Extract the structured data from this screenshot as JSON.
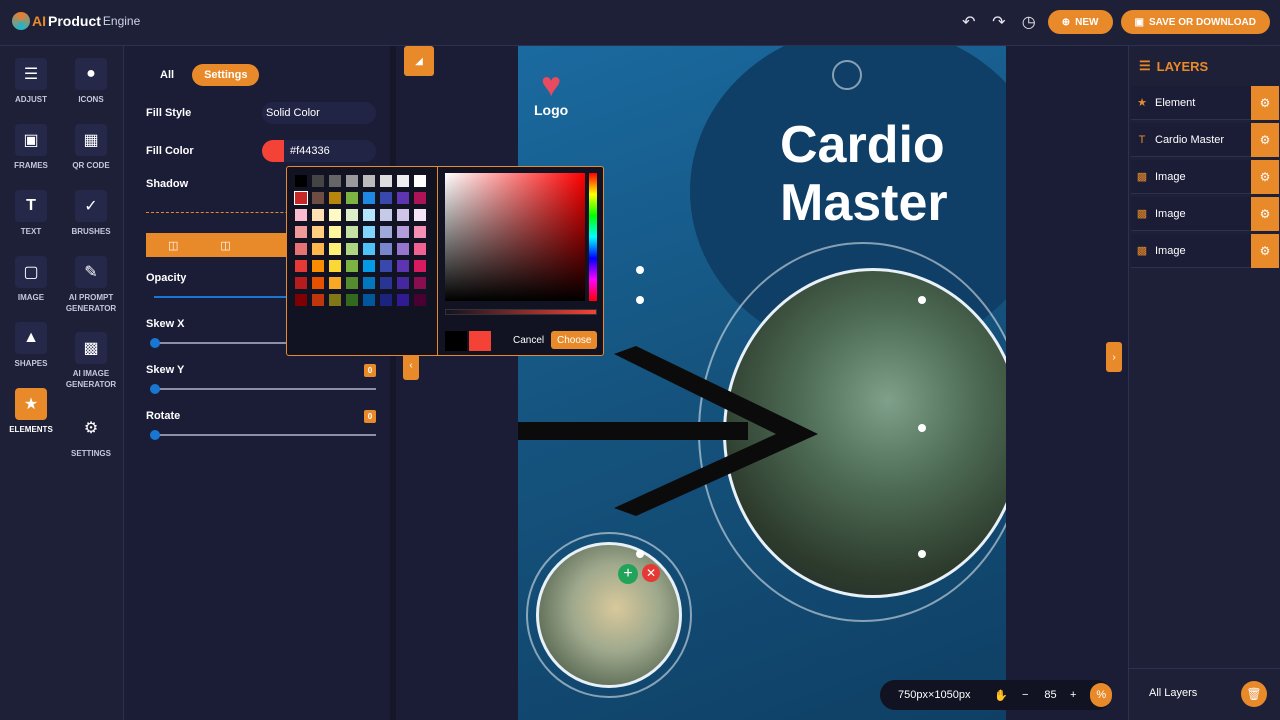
{
  "app": {
    "brand_ai": "AI",
    "brand_product": "Product",
    "brand_engine": "Engine"
  },
  "topbar": {
    "new_label": "NEW",
    "save_label": "SAVE OR DOWNLOAD"
  },
  "tools": [
    {
      "label": "ADJUST",
      "icon": "sliders-icon"
    },
    {
      "label": "ICONS",
      "icon": "map-pin-icon"
    },
    {
      "label": "FRAMES",
      "icon": "frame-icon"
    },
    {
      "label": "QR CODE",
      "icon": "qr-code-icon"
    },
    {
      "label": "TEXT",
      "icon": "text-icon"
    },
    {
      "label": "BRUSHES",
      "icon": "brush-icon"
    },
    {
      "label": "IMAGE",
      "icon": "image-add-icon"
    },
    {
      "label": "AI PROMPT GENERATOR",
      "icon": "pencil-icon"
    },
    {
      "label": "SHAPES",
      "icon": "shapes-icon"
    },
    {
      "label": "AI IMAGE GENERATOR",
      "icon": "image-icon"
    },
    {
      "label": "ELEMENTS",
      "icon": "star-icon"
    },
    {
      "label": "SETTINGS",
      "icon": "gear-icon"
    }
  ],
  "panel": {
    "tab_all": "All",
    "tab_settings": "Settings",
    "fill_style_label": "Fill Style",
    "fill_style_value": "Solid Color",
    "fill_color_label": "Fill Color",
    "fill_color_value": "#f44336",
    "shadow_label": "Shadow",
    "opacity_label": "Opacity",
    "skew_x_label": "Skew X",
    "skew_y_label": "Skew Y",
    "skew_y_value": "0",
    "rotate_label": "Rotate",
    "rotate_value": "0"
  },
  "picker": {
    "cancel_label": "Cancel",
    "choose_label": "Choose",
    "selected_color": "#f44336"
  },
  "poster": {
    "logo_text": "Logo",
    "title_line1": "Cardio",
    "title_line2": "Master"
  },
  "zoom": {
    "size_label": "750px×1050px",
    "level": "85",
    "minus": "−",
    "plus": "+",
    "percent": "%"
  },
  "layers": {
    "title": "LAYERS",
    "items": [
      {
        "label": "Element",
        "icon": "star-icon"
      },
      {
        "label": "Cardio Master",
        "icon": "text-icon"
      },
      {
        "label": "Image",
        "icon": "image-icon"
      },
      {
        "label": "Image",
        "icon": "image-icon"
      },
      {
        "label": "Image",
        "icon": "image-icon"
      }
    ],
    "footer_label": "All Layers"
  },
  "colors": {
    "accent": "#e98a2a",
    "bg": "#1b1d36",
    "fill": "#f44336"
  }
}
